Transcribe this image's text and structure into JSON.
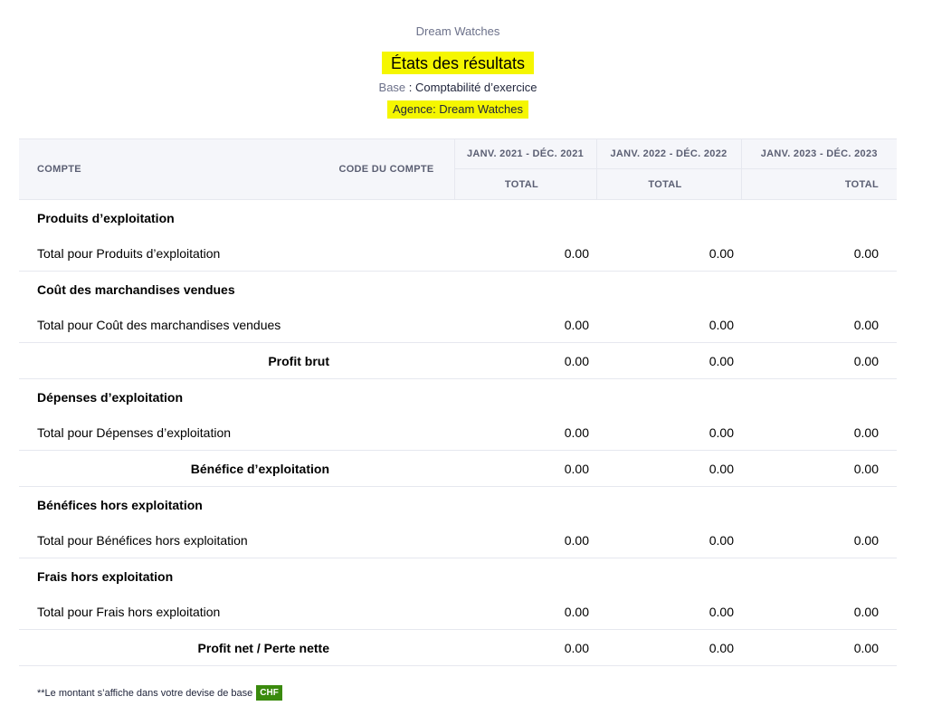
{
  "header": {
    "org_name": "Dream Watches",
    "title": "États des résultats",
    "basis_label": "Base",
    "basis_value": "Comptabilité d’exercice",
    "agency": "Agence: Dream Watches"
  },
  "highlight_color": "#f5f600",
  "table": {
    "col_account": "COMPTE",
    "col_account_code": "CODE DU COMPTE",
    "periods": [
      {
        "label": "JANV. 2021 - DÉC. 2021",
        "sub": "TOTAL"
      },
      {
        "label": "JANV. 2022 - DÉC. 2022",
        "sub": "TOTAL"
      },
      {
        "label": "JANV. 2023 - DÉC. 2023",
        "sub": "TOTAL"
      }
    ],
    "rows": [
      {
        "kind": "section",
        "name": "Produits d’exploitation"
      },
      {
        "kind": "total",
        "name": "Total pour Produits d’exploitation",
        "values": [
          "0.00",
          "0.00",
          "0.00"
        ]
      },
      {
        "kind": "section",
        "name": "Coût des marchandises vendues"
      },
      {
        "kind": "total",
        "name": "Total pour Coût des marchandises vendues",
        "values": [
          "0.00",
          "0.00",
          "0.00"
        ]
      },
      {
        "kind": "summary",
        "name": "Profit brut",
        "values": [
          "0.00",
          "0.00",
          "0.00"
        ]
      },
      {
        "kind": "section",
        "name": "Dépenses d’exploitation"
      },
      {
        "kind": "total",
        "name": "Total pour Dépenses d’exploitation",
        "values": [
          "0.00",
          "0.00",
          "0.00"
        ]
      },
      {
        "kind": "summary",
        "name": "Bénéfice d’exploitation",
        "values": [
          "0.00",
          "0.00",
          "0.00"
        ]
      },
      {
        "kind": "section",
        "name": "Bénéfices hors exploitation"
      },
      {
        "kind": "total",
        "name": "Total pour Bénéfices hors exploitation",
        "values": [
          "0.00",
          "0.00",
          "0.00"
        ]
      },
      {
        "kind": "section",
        "name": "Frais hors exploitation"
      },
      {
        "kind": "total",
        "name": "Total pour Frais hors exploitation",
        "values": [
          "0.00",
          "0.00",
          "0.00"
        ]
      },
      {
        "kind": "summary",
        "name": "Profit net / Perte nette",
        "values": [
          "0.00",
          "0.00",
          "0.00"
        ]
      }
    ]
  },
  "footnote": {
    "text": "**Le montant s’affiche dans votre devise de base",
    "currency": "CHF",
    "currency_color": "#3a8a0d"
  }
}
